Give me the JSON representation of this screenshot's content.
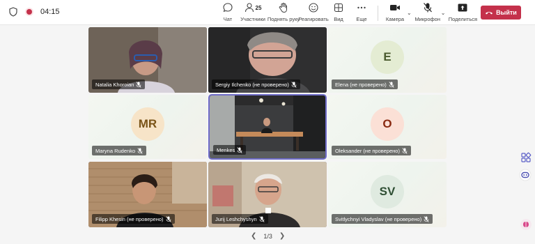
{
  "call": {
    "timer": "04:15"
  },
  "toolbar": {
    "chat": "Чат",
    "participants": "Участники",
    "participants_count": "25",
    "raise_hand": "Поднять руку",
    "react": "Реагировать",
    "view": "Вид",
    "more": "Еще",
    "camera": "Камера",
    "mic": "Микрофон",
    "share": "Поделиться",
    "leave": "Выйти"
  },
  "tiles": [
    {
      "name": "Natalia Khoroian"
    },
    {
      "name": "Sergiy Ilchenko (не проверено)"
    },
    {
      "name": "Elena (не проверено)",
      "initials": "E"
    },
    {
      "name": "Maryna Rudenko",
      "initials": "MR"
    },
    {
      "name": "Menkes"
    },
    {
      "name": "Oleksander (не проверено)",
      "initials": "O"
    },
    {
      "name": "Filipp Khesin (не проверено)"
    },
    {
      "name": "Jurij Leshchyshyn"
    },
    {
      "name": "Svitlychnyi Vladyslav (не проверено)",
      "initials": "SV"
    }
  ],
  "pager": {
    "label": "1/3"
  },
  "colors": {
    "accent": "#6f6cc9",
    "leave": "#c4314b"
  }
}
